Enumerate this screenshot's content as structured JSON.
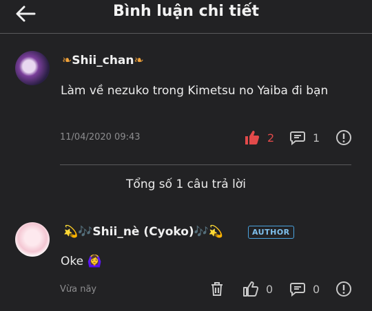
{
  "header": {
    "title": "Bình luận chi tiết"
  },
  "comment": {
    "username": "Shii_chan",
    "text": "Làm về nezuko trong Kimetsu no Yaiba đi bạn",
    "date": "11/04/2020 09:43",
    "likes": "2",
    "replies": "1"
  },
  "replies_summary": "Tổng số 1 câu trả lời",
  "reply": {
    "username": "💫🎶Shii_nè (Cyoko)🎶💫",
    "badge": "AUTHOR",
    "text": "Oke 🙆‍♀️",
    "time": "Vừa nãy",
    "likes": "0",
    "replies": "0"
  },
  "colors": {
    "background": "#222224",
    "like_active": "#e24a4a",
    "badge": "#4aa3e0"
  }
}
